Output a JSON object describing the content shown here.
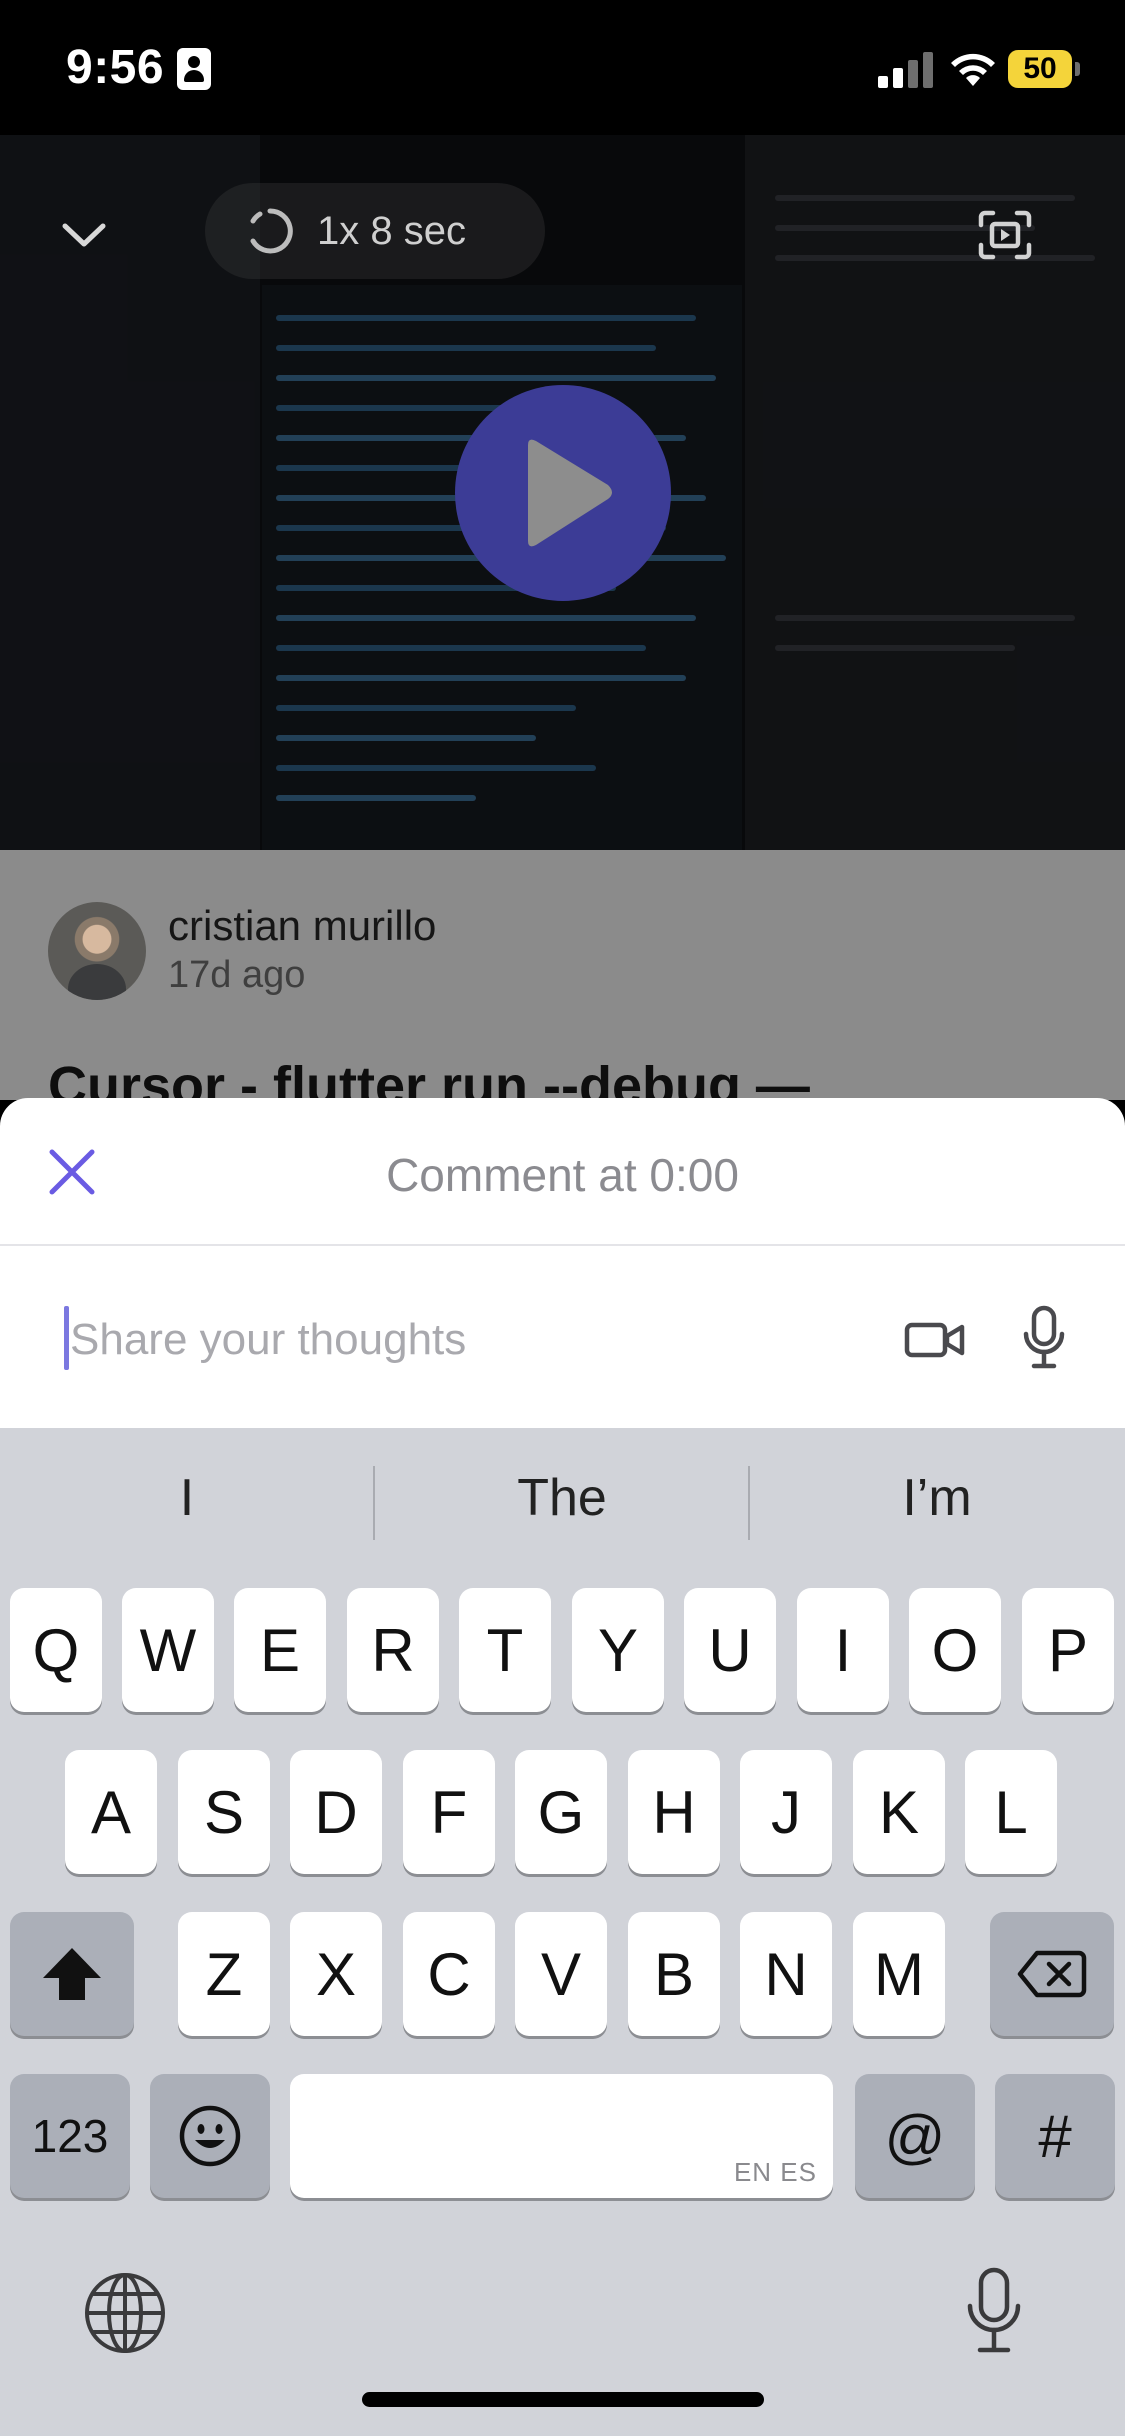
{
  "status_bar": {
    "time": "9:56",
    "battery": "50",
    "icons": [
      "id-card-icon",
      "cellular-signal-icon",
      "wifi-icon",
      "battery-icon"
    ]
  },
  "video": {
    "speed_label": "1x 8 sec",
    "icons": [
      "chevron-down-icon",
      "playback-speed-icon",
      "fullscreen-icon",
      "play-icon"
    ]
  },
  "post": {
    "author": "cristian murillo",
    "age": "17d ago",
    "title": "Cursor - flutter run --debug —"
  },
  "comment_sheet": {
    "title": "Comment at 0:00",
    "input_value": "",
    "input_placeholder": "Share your thoughts",
    "icons": [
      "close-icon",
      "video-camera-icon",
      "microphone-icon"
    ]
  },
  "keyboard": {
    "suggestions": [
      "I",
      "The",
      "I’m"
    ],
    "row1": [
      "Q",
      "W",
      "E",
      "R",
      "T",
      "Y",
      "U",
      "I",
      "O",
      "P"
    ],
    "row2": [
      "A",
      "S",
      "D",
      "F",
      "G",
      "H",
      "J",
      "K",
      "L"
    ],
    "row3": [
      "Z",
      "X",
      "C",
      "V",
      "B",
      "N",
      "M"
    ],
    "numbers_key": "123",
    "space_hint": "EN ES",
    "at_key": "@",
    "hash_key": "#",
    "icons": [
      "shift-icon",
      "backspace-icon",
      "emoji-icon",
      "globe-icon",
      "dictation-mic-icon"
    ]
  }
}
